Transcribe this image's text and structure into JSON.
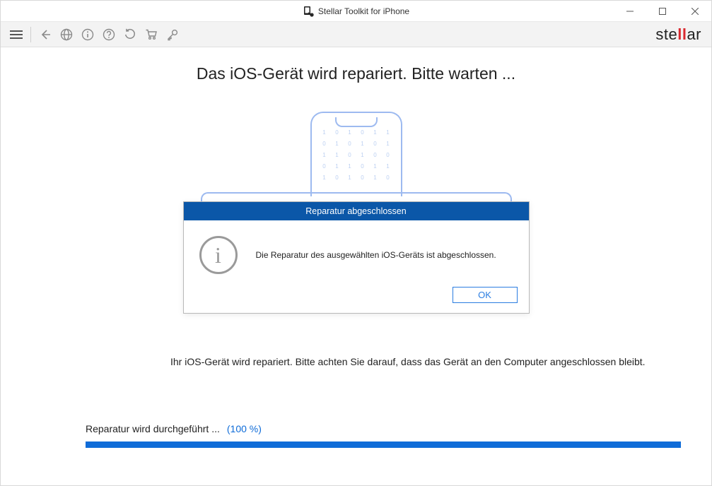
{
  "window": {
    "title": "Stellar Toolkit for iPhone"
  },
  "brand": {
    "pre": "ste",
    "accent": "ll",
    "post": "ar"
  },
  "main": {
    "heading": "Das iOS-Gerät wird repariert. Bitte warten ...",
    "info_text": "Ihr iOS-Gerät wird repariert. Bitte achten Sie darauf, dass das Gerät an den Computer angeschlossen bleibt."
  },
  "progress": {
    "label": "Reparatur wird durchgeführt ...",
    "percent_text": "(100 %)",
    "percent_value": 100
  },
  "dialog": {
    "title": "Reparatur abgeschlossen",
    "message": "Die Reparatur des ausgewählten iOS-Geräts ist abgeschlossen.",
    "ok": "OK"
  }
}
